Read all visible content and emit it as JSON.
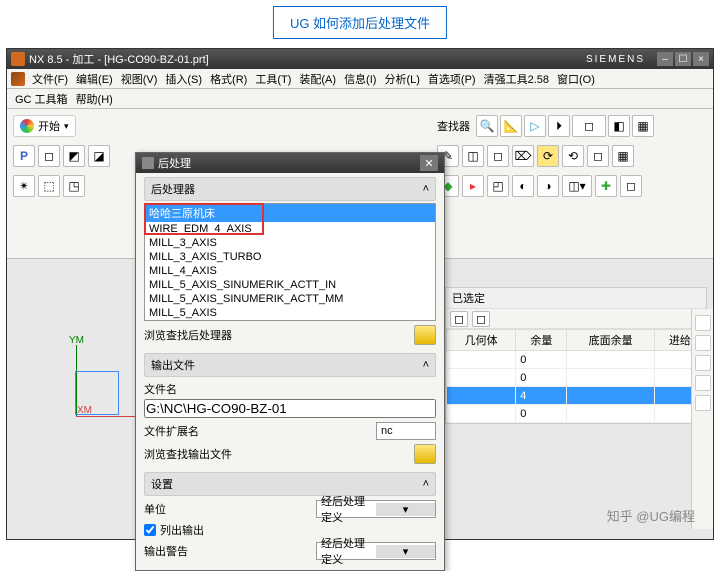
{
  "caption": "UG 如何添加后处理文件",
  "titlebar": {
    "icon": "NX",
    "text": "NX 8.5 - 加工 - [HG-CO90-BZ-01.prt]",
    "brand": "SIEMENS"
  },
  "menubar": [
    "文件(F)",
    "编辑(E)",
    "视图(V)",
    "插入(S)",
    "格式(R)",
    "工具(T)",
    "装配(A)",
    "信息(I)",
    "分析(L)",
    "首选项(P)",
    "清强工具2.58",
    "窗口(O)"
  ],
  "menubar2": [
    "GC 工具箱",
    "帮助(H)"
  ],
  "start_label": "开始",
  "dialog": {
    "title": "后处理",
    "section_processor": "后处理器",
    "processors": [
      "哈哈三原机床",
      "WIRE_EDM_4_AXIS",
      "MILL_3_AXIS",
      "MILL_3_AXIS_TURBO",
      "MILL_4_AXIS",
      "MILL_5_AXIS_SINUMERIK_ACTT_IN",
      "MILL_5_AXIS_SINUMERIK_ACTT_MM",
      "MILL_5_AXIS"
    ],
    "browse_processor": "浏览查找后处理器",
    "section_output": "输出文件",
    "filename_label": "文件名",
    "filename_value": "G:\\NC\\HG-CO90-BZ-01",
    "ext_label": "文件扩展名",
    "ext_value": "nc",
    "browse_output": "浏览查找输出文件",
    "section_settings": "设置",
    "unit_label": "单位",
    "unit_value": "经后处理定义",
    "list_output_label": "列出输出",
    "warn_label": "输出警告",
    "warn_value": "经后处理定义"
  },
  "right_pane": {
    "header": "已选定",
    "columns": [
      "几何体",
      "余量",
      "底面余量",
      "进给"
    ],
    "rows": [
      {
        "a": "",
        "b": "0",
        "c": "",
        "d": ""
      },
      {
        "a": "",
        "b": "0",
        "c": "",
        "d": ""
      },
      {
        "a": "",
        "b": "4",
        "c": "",
        "d": "",
        "sel": true
      },
      {
        "a": "",
        "b": "0",
        "c": "",
        "d": ""
      }
    ]
  },
  "coord": {
    "y": "YM",
    "x": "XM"
  },
  "watermark": "知乎 @UG编程",
  "bg_label": "查找器"
}
